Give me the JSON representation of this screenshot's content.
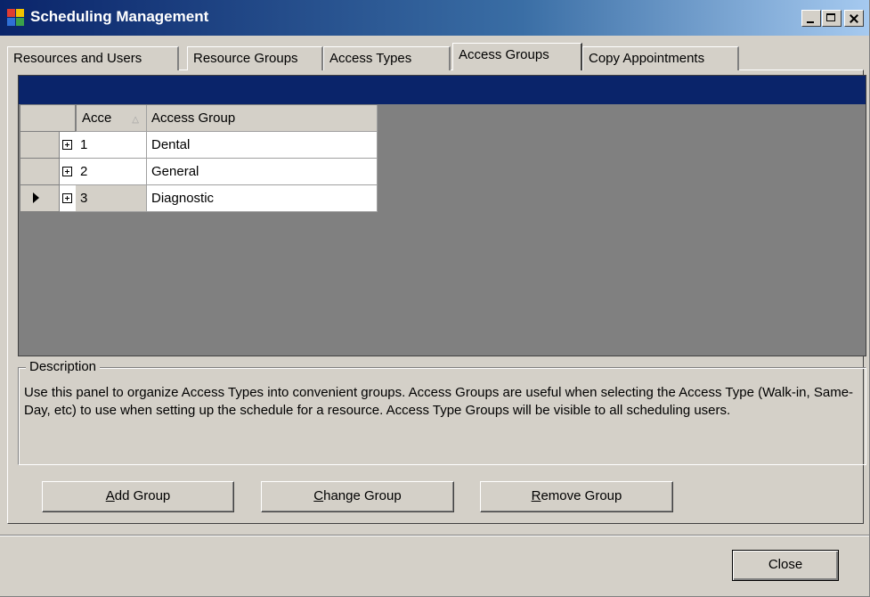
{
  "window": {
    "title": "Scheduling Management"
  },
  "tabs": [
    {
      "label": "Resources and Users",
      "active": false
    },
    {
      "label": "Resource Groups",
      "active": false
    },
    {
      "label": "Access Types",
      "active": false
    },
    {
      "label": "Access Groups",
      "active": true
    },
    {
      "label": "Copy Appointments",
      "active": false
    }
  ],
  "grid": {
    "columns": [
      "Acce",
      "Access Group"
    ],
    "sort_column": "Acce",
    "sort_direction": "ascending",
    "rows": [
      {
        "id": "1",
        "name": "Dental"
      },
      {
        "id": "2",
        "name": "General"
      },
      {
        "id": "3",
        "name": "Diagnostic"
      }
    ],
    "current_row": 3
  },
  "description": {
    "title": "Description",
    "text": "Use this panel to organize Access Types into convenient groups.  Access Groups are useful when selecting the Access Type (Walk-in, Same-Day, etc) to use when setting up the schedule for a resource.  Access Type Groups will be visible to all scheduling users."
  },
  "buttons": {
    "add_group_mnemonic": "A",
    "add_group_rest": "dd Group",
    "change_group_mnemonic": "C",
    "change_group_rest": "hange Group",
    "remove_group_mnemonic": "R",
    "remove_group_rest": "emove Group",
    "close": "Close"
  },
  "colors": {
    "titlebar_start": "#0a246a",
    "titlebar_end": "#a6caf0",
    "grid_caption": "#0a246a",
    "grid_background": "#808080",
    "face": "#d4d0c8"
  }
}
